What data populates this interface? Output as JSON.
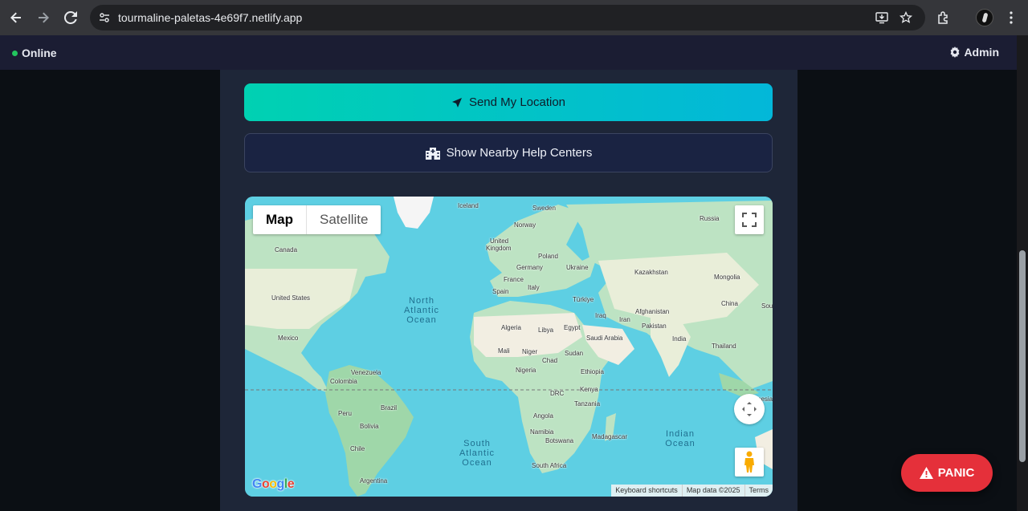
{
  "browser": {
    "url": "tourmaline-paletas-4e69f7.netlify.app",
    "icons": [
      "back-icon",
      "forward-icon",
      "reload-icon",
      "site-info-icon",
      "install-icon",
      "star-icon",
      "extensions-icon",
      "profile-avatar",
      "menu-icon"
    ]
  },
  "header": {
    "status_label": "Online",
    "status_color": "#22c55e",
    "admin_label": "Admin"
  },
  "actions": {
    "send_location_label": "Send My Location",
    "help_centers_label": "Show Nearby Help Centers"
  },
  "map": {
    "type_map": "Map",
    "type_satellite": "Satellite",
    "attribution": {
      "shortcuts": "Keyboard shortcuts",
      "data": "Map data ©2025",
      "terms": "Terms"
    },
    "labels": {
      "iceland": "Iceland",
      "sweden": "Sweden",
      "norway": "Norway",
      "russia": "Russia",
      "canada": "Canada",
      "uk1": "United",
      "uk2": "Kingdom",
      "poland": "Poland",
      "germany": "Germany",
      "ukraine": "Ukraine",
      "kazakhstan": "Kazakhstan",
      "mongolia": "Mongolia",
      "france": "France",
      "spain": "Spain",
      "italy": "Italy",
      "turkiye": "Türkiye",
      "us": "United States",
      "china": "China",
      "sou": "Sou",
      "afghanistan": "Afghanistan",
      "iraq": "Iraq",
      "iran": "Iran",
      "pakistan": "Pakistan",
      "algeria": "Algeria",
      "libya": "Libya",
      "egypt": "Egypt",
      "saudi": "Saudi Arabia",
      "mexico": "Mexico",
      "india": "India",
      "thailand": "Thailand",
      "mali": "Mali",
      "niger": "Niger",
      "sudan": "Sudan",
      "chad": "Chad",
      "venezuela": "Venezuela",
      "nigeria": "Nigeria",
      "ethiopia": "Ethiopia",
      "colombia": "Colombia",
      "kenya": "Kenya",
      "drc": "DRC",
      "brazil": "Brazil",
      "tanzania": "Tanzania",
      "peru": "Peru",
      "angola": "Angola",
      "bolivia": "Bolivia",
      "namibia": "Namibia",
      "madagascar": "Madagascar",
      "botswana": "Botswana",
      "chile": "Chile",
      "south_africa": "South Africa",
      "argentina": "Argentina",
      "indonesia": "nesia"
    },
    "oceans": {
      "north_atlantic": "North Atlantic Ocean",
      "south_atlantic": "South Atlantic Ocean",
      "indian": "Indian Ocean"
    },
    "logo": "Google",
    "water_color": "#5ecfe3",
    "land_color": "#bde3c3"
  },
  "panic": {
    "label": "PANIC",
    "color": "#e5303a"
  }
}
